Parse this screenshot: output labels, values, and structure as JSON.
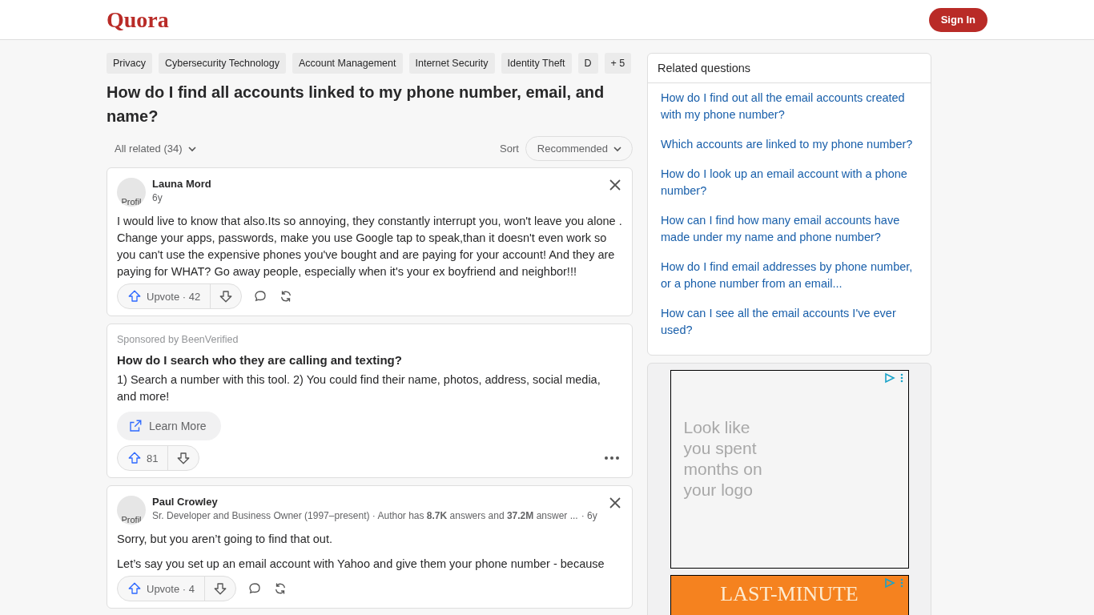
{
  "header": {
    "logo": "Quora",
    "sign_in": "Sign In"
  },
  "topics": [
    "Privacy",
    "Cybersecurity Technology",
    "Account Management",
    "Internet Security",
    "Identity Theft",
    "D"
  ],
  "topics_more": "+ 5",
  "question": "How do I find all accounts linked to my phone number, email, and name?",
  "filter": {
    "all_related": "All related (34)",
    "sort_label": "Sort",
    "sort_value": "Recommended"
  },
  "feed": [
    {
      "kind": "answer",
      "avatar_alt": "Profil",
      "author": "Launa Mord",
      "meta": "6y",
      "body": [
        "I would live to know that also.Its so annoying, they constantly interrupt you, won't leave you alone . Change your apps, passwords, make you use Google tap to speak,than it doesn't even work so you can't use the expensive phones you've bought and are paying for your account! And they are paying for WHAT? Go away people, especially when it's your ex boyfriend and neighbor!!!"
      ],
      "upvote": "Upvote · 42"
    },
    {
      "kind": "ad",
      "sponsor": "Sponsored by BeenVerified",
      "title": "How do I search who they are calling and texting?",
      "body": [
        "1) Search a number with this tool. 2) You could find their name, photos, address, social media, and more!"
      ],
      "cta": "Learn More",
      "upvote": "81"
    },
    {
      "kind": "answer",
      "avatar_alt": "Profil",
      "author": "Paul Crowley",
      "credential": "Sr. Developer and Business Owner (1997–present) · Author has **8.7K** answers and **37.2M** answer ...",
      "meta": "· 6y",
      "body": [
        "Sorry, but you aren’t going to find that out.",
        "Let’s say you set up an email account with Yahoo and give them your phone number - because"
      ],
      "upvote": "Upvote · 4"
    }
  ],
  "related": {
    "title": "Related questions",
    "items": [
      "How do I find out all the email accounts created with my phone number?",
      "Which accounts are linked to my phone number?",
      "How do I look up an email account with a phone number?",
      "How can I find how many email accounts have made under my name and phone number?",
      "How do I find email addresses by phone number, or a phone number from an email...",
      "How can I see all the email accounts I've ever used?"
    ]
  },
  "ads": [
    {
      "kind": "text",
      "text": "Look like you spent months on your logo"
    },
    {
      "kind": "banner",
      "text": "LAST-MINUTE"
    }
  ]
}
